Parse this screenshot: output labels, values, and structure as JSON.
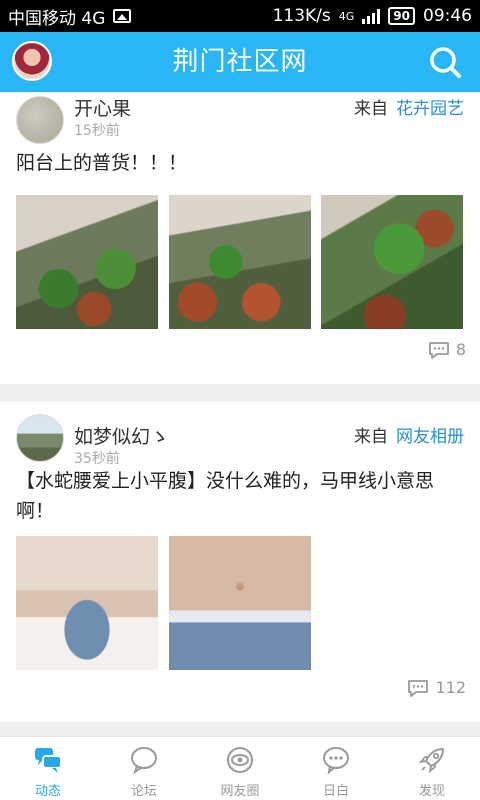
{
  "status_bar": {
    "carrier": "中国移动 4G",
    "speed": "113K/s",
    "signal_label": "4G",
    "battery": "90",
    "time": "09:46"
  },
  "header": {
    "title": "荆门社区网"
  },
  "posts": [
    {
      "author": "开心果",
      "time": "15秒前",
      "from_label": "来自",
      "source": "花卉园艺",
      "text": "阳台上的普货！！！",
      "comments": "8"
    },
    {
      "author": "如梦似幻ゝ",
      "time": "35秒前",
      "from_label": "来自",
      "source": "网友相册",
      "text": "【水蛇腰爱上小平腹】没什么难的，马甲线小意思啊！",
      "comments": "112"
    }
  ],
  "nav": {
    "items": [
      {
        "label": "动态",
        "icon": "chat-bubbles-icon"
      },
      {
        "label": "论坛",
        "icon": "speech-bubble-icon"
      },
      {
        "label": "网友圈",
        "icon": "eye-circle-icon"
      },
      {
        "label": "日白",
        "icon": "dots-bubble-icon"
      },
      {
        "label": "发现",
        "icon": "rocket-icon"
      }
    ],
    "active_color": "#29a8e8",
    "inactive_color": "#9a9a9a"
  },
  "colors": {
    "header_bg": "#29b6f6",
    "link": "#2a8fd0"
  }
}
